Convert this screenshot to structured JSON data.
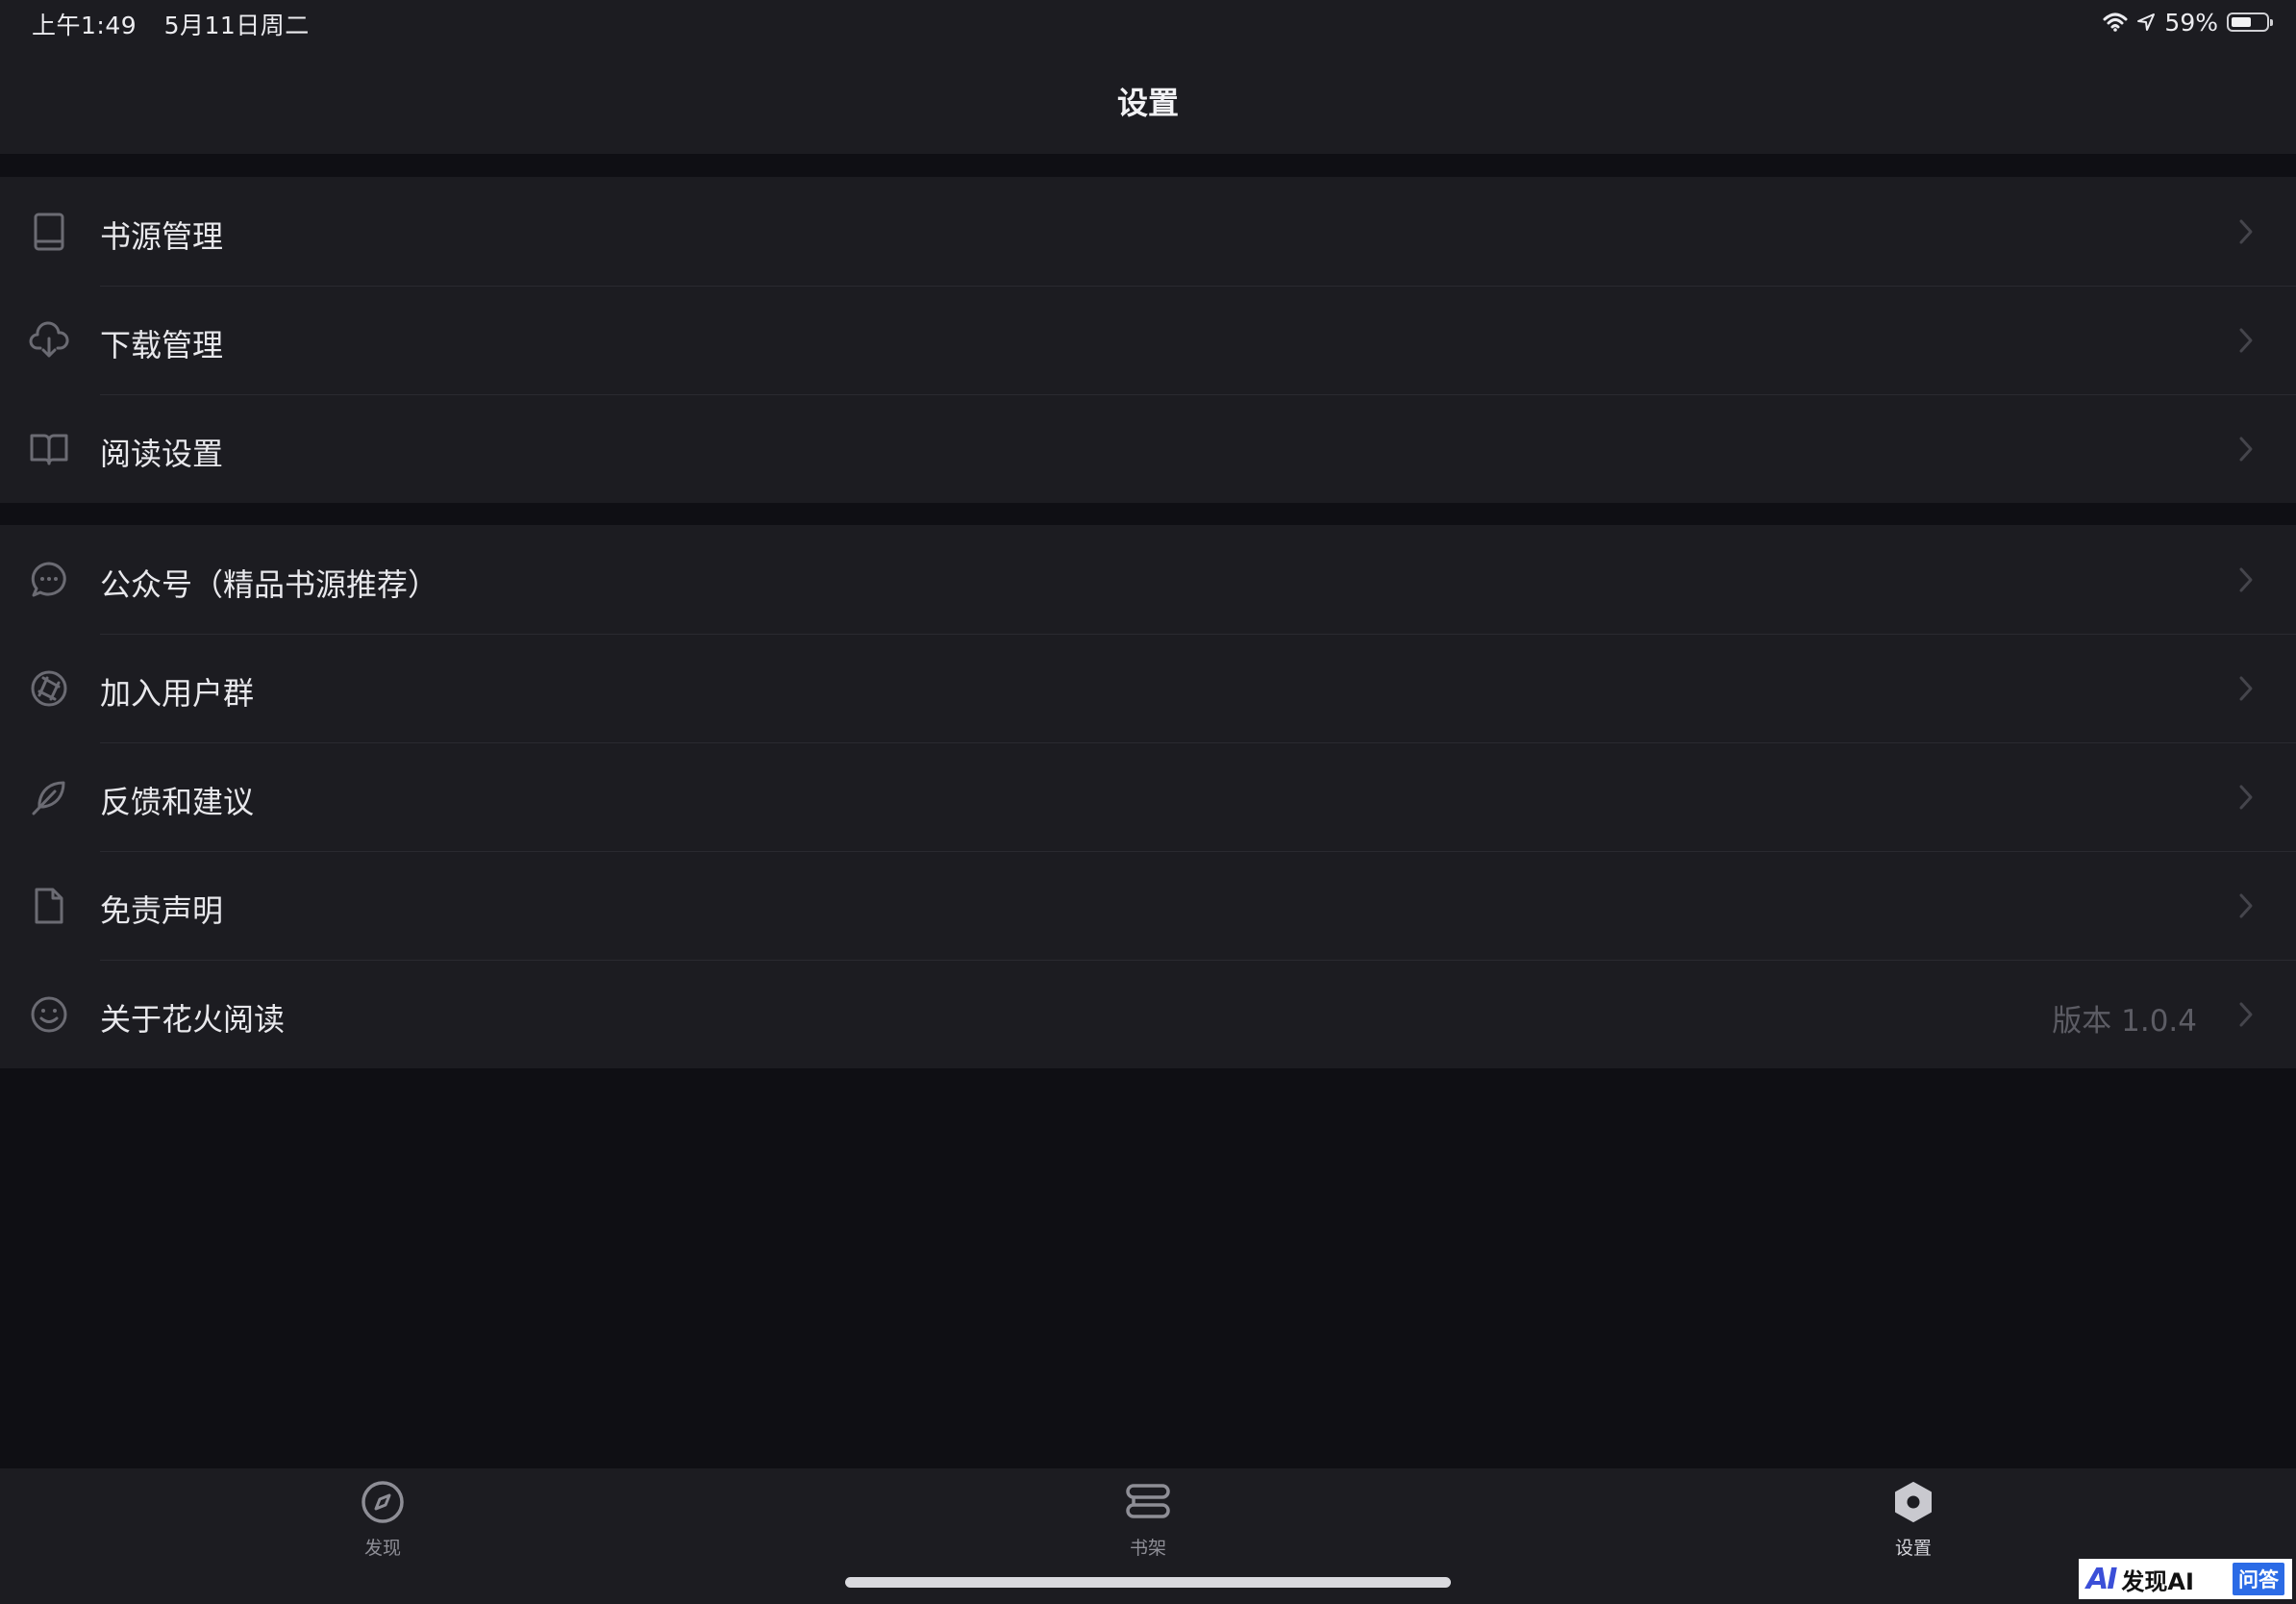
{
  "status_bar": {
    "time": "上午1:49",
    "date": "5月11日周二",
    "battery_percent_text": "59%",
    "battery_level": 0.59,
    "wifi_icon": "wifi-icon",
    "location_icon": "location-arrow-icon"
  },
  "nav": {
    "title": "设置"
  },
  "group1": {
    "items": [
      {
        "label": "书源管理",
        "icon": "book-icon"
      },
      {
        "label": "下载管理",
        "icon": "cloud-download-icon"
      },
      {
        "label": "阅读设置",
        "icon": "open-book-icon"
      }
    ]
  },
  "group2": {
    "items": [
      {
        "label": "公众号（精品书源推荐）",
        "icon": "chat-bubble-icon"
      },
      {
        "label": "加入用户群",
        "icon": "aperture-icon"
      },
      {
        "label": "反馈和建议",
        "icon": "feather-icon"
      },
      {
        "label": "免责声明",
        "icon": "document-icon"
      },
      {
        "label": "关于花火阅读",
        "icon": "smile-icon",
        "detail": "版本 1.0.4"
      }
    ]
  },
  "tabs": [
    {
      "label": "发现",
      "icon": "compass-icon",
      "active": false
    },
    {
      "label": "书架",
      "icon": "bookshelf-icon",
      "active": false
    },
    {
      "label": "设置",
      "icon": "hexagon-settings-icon",
      "active": true
    }
  ],
  "watermark": {
    "logo": "AI",
    "text": "发现AI",
    "badge": "问答"
  },
  "colors": {
    "background": "#0f0f14",
    "surface": "#1c1c21",
    "icon_gray": "#6b6b73",
    "chevron": "#45454c"
  }
}
